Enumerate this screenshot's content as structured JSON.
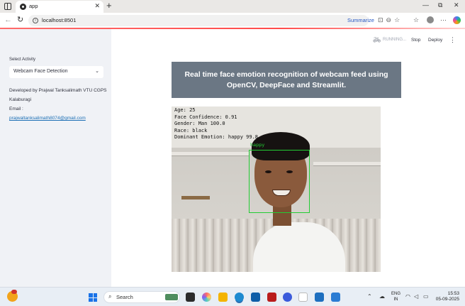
{
  "browser": {
    "tab_title": "app",
    "tab_close": "✕",
    "new_tab": "+",
    "url": "localhost:8501",
    "summarize": "Summarize",
    "win_minimize": "—",
    "win_restore": "⧉",
    "win_close": "✕"
  },
  "sidebar": {
    "select_label": "Select Activity",
    "select_value": "Webcam Face Detection",
    "developer_line": "Developed by Prajwal Tanksalimath VTU CGPS Kalaburagi",
    "email_label": "Email :",
    "email": "prajwaltanksalimath8074@gmail.com"
  },
  "toolbar": {
    "running": "RUNNING...",
    "stop": "Stop",
    "deploy": "Deploy"
  },
  "main": {
    "banner_title": "Real time face emotion recognition of webcam feed using OpenCV, DeepFace and Streamlit."
  },
  "analysis": {
    "age": "Age: 25",
    "face_confidence": "Face Confidence: 0.91",
    "gender": "Gender: Man 100.0",
    "race": "Race: black",
    "dominant_emotion": "Dominant Emotion: happy 99.8",
    "box_label": "happy"
  },
  "taskbar": {
    "search_placeholder": "Search",
    "lang_line1": "ENG",
    "lang_line2": "IN",
    "time": "15:53",
    "date": "05-09-2025"
  },
  "colors": {
    "accent_red": "#ff4b4b",
    "banner_bg": "#6b7784",
    "detection_green": "#22cc33",
    "sidebar_bg": "#f0f2f6"
  },
  "icons": [
    "sidebar-toggle-icon",
    "back-icon",
    "reload-icon",
    "info-icon",
    "favorite-icon",
    "more-icon",
    "copilot-icon",
    "windows-start-icon",
    "search-icon"
  ]
}
